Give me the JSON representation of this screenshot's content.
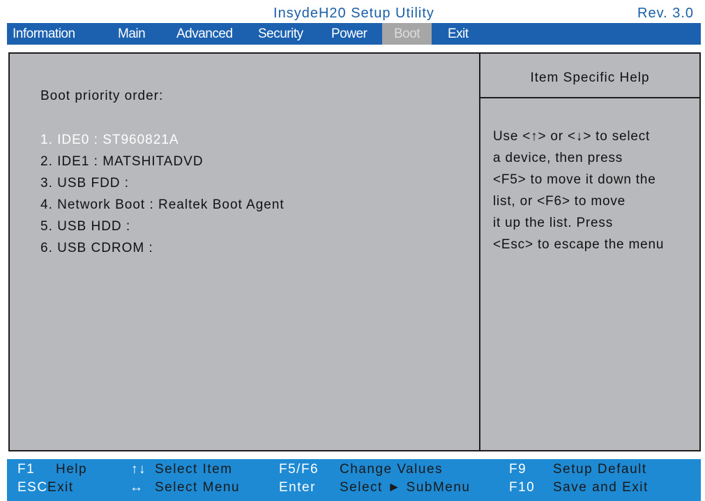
{
  "title": "InsydeH20 Setup Utility",
  "rev": "Rev. 3.0",
  "menu": [
    "Information",
    "Main",
    "Advanced",
    "Security",
    "Power",
    "Boot",
    "Exit"
  ],
  "active_menu": "Boot",
  "boot": {
    "label": "Boot priority order:",
    "items": [
      "1. IDE0 : ST960821A",
      "2. IDE1 : MATSHITADVD",
      "3. USB FDD :",
      "4. Network Boot : Realtek Boot Agent",
      "5. USB HDD :",
      "6. USB CDROM :"
    ]
  },
  "help": {
    "title": "Item Specific Help",
    "lines": [
      "Use <↑> or <↓> to select",
      "a device, then press",
      "<F5> to move it down the",
      "list, or <F6> to move",
      "it up the list. Press",
      "<Esc> to escape the menu"
    ]
  },
  "footer": {
    "f1_key": "F1",
    "f1_desc": "Help",
    "esc_key": "ESC",
    "esc_desc": "Exit",
    "updown_key": "↑↓",
    "updown_desc": "Select  Item",
    "leftright_key": "↔",
    "leftright_desc": "Select  Menu",
    "f5f6_key": "F5/F6",
    "f5f6_desc": "Change  Values",
    "enter_key": "Enter",
    "enter_desc": "Select ► SubMenu",
    "f9_key": "F9",
    "f9_desc": "Setup  Default",
    "f10_key": "F10",
    "f10_desc": "Save  and  Exit"
  },
  "colors": {
    "menu_bar": "#1b61b0",
    "footer": "#1f8ad4",
    "panel": "#b8b9bc",
    "title_text": "#1a5fa8"
  }
}
